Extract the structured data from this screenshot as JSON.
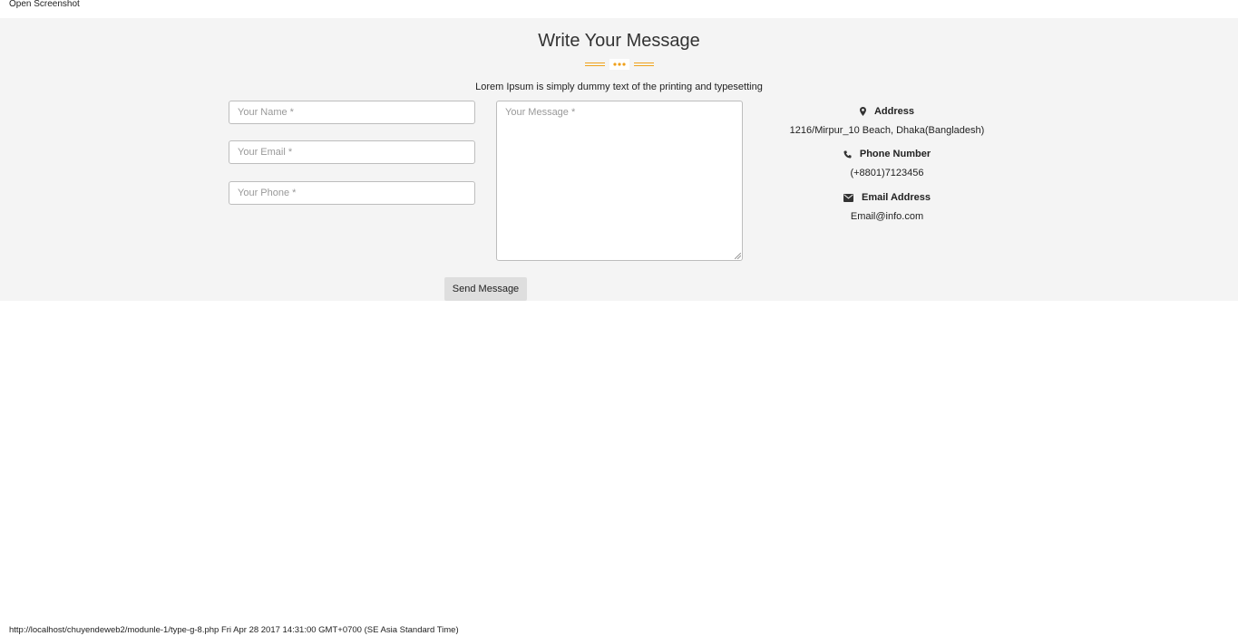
{
  "header": {
    "label": "Open Screenshot"
  },
  "contact": {
    "title": "Write Your Message",
    "subtitle": "Lorem Ipsum is simply dummy text of the printing and typesetting",
    "accent_color": "#f0a11b",
    "form": {
      "name_placeholder": "Your Name *",
      "email_placeholder": "Your Email *",
      "phone_placeholder": "Your Phone *",
      "message_placeholder": "Your Message *",
      "send_label": "Send Message"
    },
    "info": {
      "address_label": "Address",
      "address_value": "1216/Mirpur_10 Beach, Dhaka(Bangladesh)",
      "phone_label": "Phone Number",
      "phone_value": "(+8801)7123456",
      "email_label": "Email Address",
      "email_value": "Email@info.com"
    }
  },
  "footer": {
    "url": "http://localhost/chuyendeweb2/modunle-1/type-g-8.php Fri Apr 28 2017 14:31:00 GMT+0700 (SE Asia Standard Time)"
  }
}
